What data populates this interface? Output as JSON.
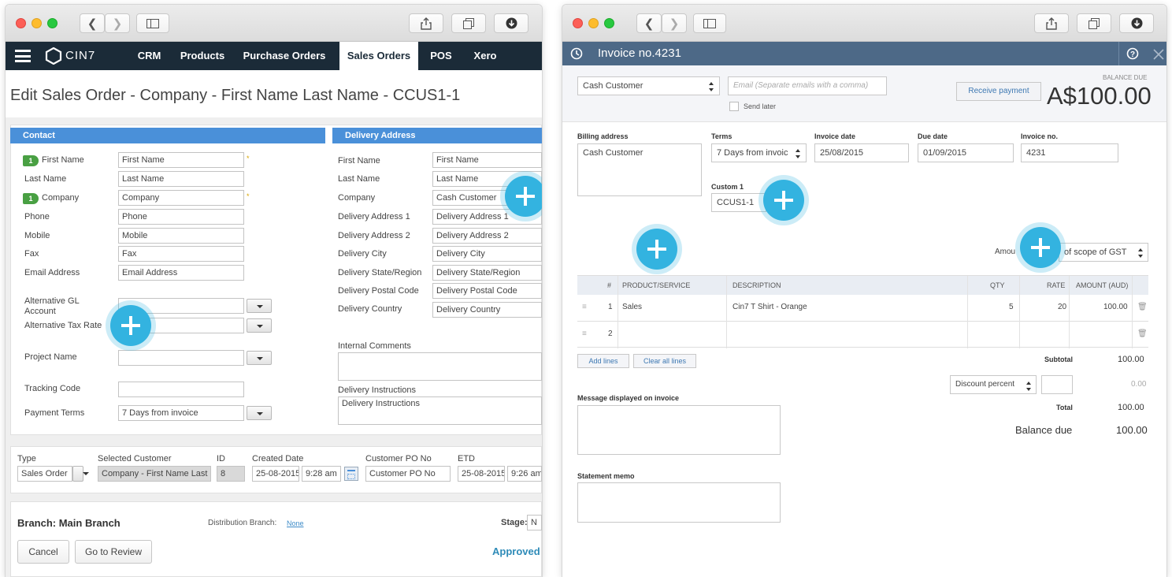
{
  "left": {
    "nav": {
      "brand": "CIN7",
      "items": [
        "CRM",
        "Products",
        "Purchase Orders",
        "Sales Orders",
        "POS",
        "Xero"
      ],
      "active": "Sales Orders"
    },
    "page_title": "Edit Sales Order - Company - First Name Last Name - CCUS1-1",
    "contact": {
      "heading": "Contact",
      "first_name_label": "First Name",
      "first_name_value": "First Name",
      "last_name_label": "Last Name",
      "last_name_value": "Last Name",
      "company_label": "Company",
      "company_value": "Company",
      "phone_label": "Phone",
      "phone_value": "Phone",
      "mobile_label": "Mobile",
      "mobile_value": "Mobile",
      "fax_label": "Fax",
      "fax_value": "Fax",
      "email_label": "Email Address",
      "email_value": "Email Address",
      "alt_gl_label": "Alternative GL Account",
      "alt_tax_label": "Alternative Tax Rate",
      "project_label": "Project Name",
      "tracking_label": "Tracking Code",
      "payment_terms_label": "Payment Terms",
      "payment_terms_value": "7 Days from invoice",
      "badge": "1",
      "required": "*"
    },
    "delivery": {
      "heading": "Delivery Address",
      "first_name_label": "First Name",
      "first_name_value": "First Name",
      "last_name_label": "Last Name",
      "last_name_value": "Last Name",
      "company_label": "Company",
      "company_value": "Cash Customer",
      "addr1_label": "Delivery Address 1",
      "addr1_value": "Delivery Address 1",
      "addr2_label": "Delivery Address 2",
      "addr2_value": "Delivery Address 2",
      "city_label": "Delivery City",
      "city_value": "Delivery City",
      "state_label": "Delivery State/Region",
      "state_value": "Delivery State/Region",
      "postal_label": "Delivery Postal Code",
      "postal_value": "Delivery Postal Code",
      "country_label": "Delivery Country",
      "country_value": "Delivery Country",
      "internal_comments_label": "Internal Comments",
      "instructions_label": "Delivery Instructions",
      "instructions_value": "Delivery Instructions"
    },
    "order": {
      "type_label": "Type",
      "type_value": "Sales Order",
      "customer_label": "Selected Customer",
      "customer_value": "Company - First Name Last N",
      "id_label": "ID",
      "id_value": "8",
      "created_label": "Created Date",
      "created_date": "25-08-2015",
      "created_time": "9:28 am",
      "po_label": "Customer PO No",
      "po_value": "Customer PO No",
      "etd_label": "ETD",
      "etd_date": "25-08-2015",
      "etd_time": "9:26 am"
    },
    "footer": {
      "branch": "Branch: Main Branch",
      "distribution_label": "Distribution Branch:",
      "distribution_value": "None",
      "stage_label": "Stage:",
      "stage_value": "N",
      "cancel": "Cancel",
      "review": "Go to Review",
      "status": "Approved"
    }
  },
  "right": {
    "header_title": "Invoice no.4231",
    "customer": "Cash Customer",
    "email_placeholder": "Email (Separate emails with a comma)",
    "send_later": "Send later",
    "receive_payment": "Receive payment",
    "balance_due_label": "BALANCE DUE",
    "balance_due_amount": "A$100.00",
    "billing_address_label": "Billing address",
    "billing_address_value": "Cash Customer",
    "terms_label": "Terms",
    "terms_value": "7 Days from invoic",
    "invoice_date_label": "Invoice date",
    "invoice_date_value": "25/08/2015",
    "due_date_label": "Due date",
    "due_date_value": "01/09/2015",
    "invoice_no_label": "Invoice no.",
    "invoice_no_value": "4231",
    "custom1_label": "Custom 1",
    "custom1_value": "CCUS1-1",
    "amounts_label": "Amou",
    "gst_value": "of scope of GST",
    "table": {
      "headers": [
        "#",
        "PRODUCT/SERVICE",
        "DESCRIPTION",
        "QTY",
        "RATE",
        "AMOUNT (AUD)"
      ],
      "rows": [
        {
          "num": "1",
          "product": "Sales",
          "description": "Cin7 T Shirt - Orange",
          "qty": "5",
          "rate": "20",
          "amount": "100.00"
        },
        {
          "num": "2",
          "product": "",
          "description": "",
          "qty": "",
          "rate": "",
          "amount": ""
        }
      ]
    },
    "add_lines": "Add lines",
    "clear_lines": "Clear all lines",
    "subtotal_label": "Subtotal",
    "subtotal_value": "100.00",
    "discount_label": "Discount percent",
    "discount_value": "0.00",
    "total_label": "Total",
    "total_value": "100.00",
    "balance_label": "Balance due",
    "balance_value": "100.00",
    "message_label": "Message displayed on invoice",
    "memo_label": "Statement memo"
  },
  "colors": {
    "cin7_nav": "#1b2b38",
    "section_header": "#4a90d9",
    "invoice_header": "#4d6987",
    "plus_accent": "#33b3e0",
    "approved": "#2e8bb8"
  }
}
